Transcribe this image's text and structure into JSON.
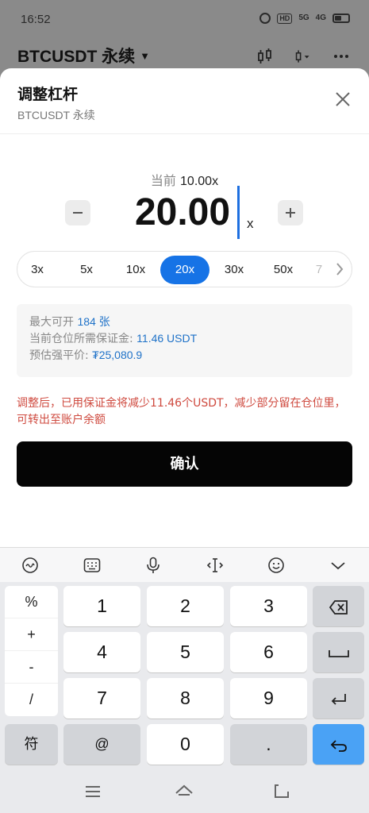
{
  "status_bar": {
    "time": "16:52",
    "hd": "HD",
    "net1": "5G",
    "net2": "4G"
  },
  "background": {
    "symbol": "BTCUSDT 永续"
  },
  "sheet": {
    "title": "调整杠杆",
    "subtitle": "BTCUSDT 永续",
    "current_prefix": "当前",
    "current_value": "10.00x",
    "leverage_value": "20.00",
    "leverage_unit": "x",
    "options": [
      "3x",
      "5x",
      "10x",
      "20x",
      "30x",
      "50x",
      "7"
    ],
    "selected_option": "20x",
    "info": {
      "max_open_label": "最大可开",
      "max_open_value": "184 张",
      "margin_label": "当前仓位所需保证金:",
      "margin_value": "11.46 USDT",
      "liq_label": "预估强平价:",
      "liq_value": "₮25,080.9"
    },
    "warning": "调整后，已用保证金将减少11.46个USDT，减少部分留在仓位里，可转出至账户余额",
    "confirm_label": "确认"
  },
  "keyboard": {
    "symbols": [
      "%",
      "+",
      "-",
      "/"
    ],
    "digits": [
      "1",
      "2",
      "3",
      "4",
      "5",
      "6",
      "7",
      "8",
      "9"
    ],
    "bottom": {
      "sym": "符",
      "at": "@",
      "zero": "0",
      "dot": "."
    }
  },
  "colors": {
    "accent": "#1673e6",
    "warning": "#cf4a3f",
    "confirm": "#050505",
    "enter_key": "#4aa2f5"
  }
}
